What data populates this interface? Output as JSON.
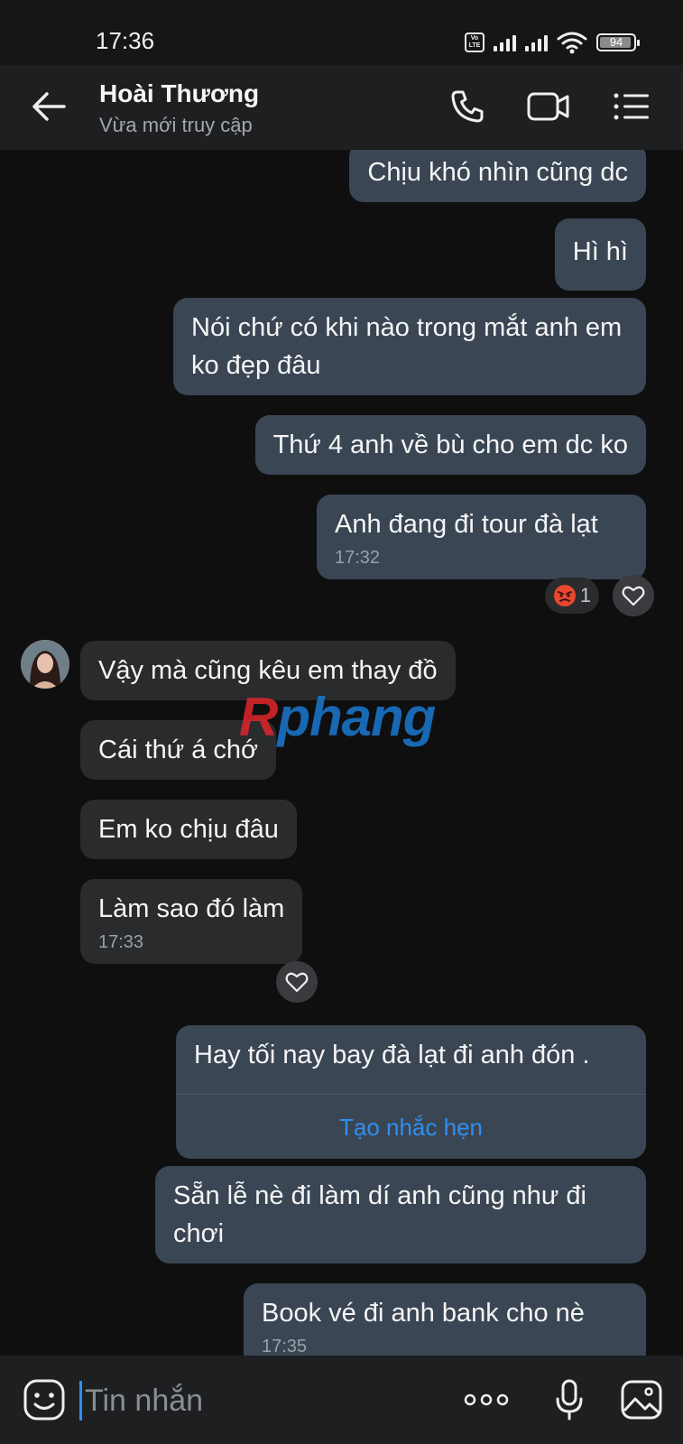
{
  "status_bar": {
    "time": "17:36",
    "volte": "Vo LTE",
    "battery": "94",
    "battery_level_percent": 94
  },
  "header": {
    "contact_name": "Hoài Thương",
    "contact_status": "Vừa mới truy cập",
    "icons": [
      "back-arrow-icon",
      "phone-icon",
      "video-call-icon",
      "menu-list-icon"
    ]
  },
  "messages": [
    {
      "side": "out",
      "text": "Chịu khó nhìn cũng dc"
    },
    {
      "side": "out",
      "text": "Hì hì"
    },
    {
      "side": "out",
      "text": "Nói chứ có khi nào trong mắt anh em ko đẹp đâu"
    },
    {
      "side": "out",
      "text": "Thứ 4 anh về bù cho em dc ko"
    },
    {
      "side": "out",
      "text": "Anh đang đi tour đà lạt",
      "time": "17:32",
      "reaction_count": "1",
      "reaction_icon": "angry-face-icon"
    },
    {
      "side": "in",
      "text": "Vậy mà cũng kêu em thay đồ"
    },
    {
      "side": "in",
      "text": "Cái thứ á chớ"
    },
    {
      "side": "in",
      "text": "Em ko chịu đâu"
    },
    {
      "side": "in",
      "text": "Làm sao đó làm",
      "time": "17:33"
    },
    {
      "side": "out",
      "text": "Hay tối nay bay đà lạt đi anh đón .",
      "action": "Tạo nhắc hẹn"
    },
    {
      "side": "out",
      "text": "Sẵn lễ nè đi làm dí anh cũng như đi chơi"
    },
    {
      "side": "out",
      "text": "Book vé đi anh bank cho nè",
      "time": "17:35"
    }
  ],
  "watermark": {
    "part1": "R",
    "part2": "phang"
  },
  "input_bar": {
    "placeholder": "Tin nhắn",
    "icons": [
      "emoji-sticker-icon",
      "more-options-icon",
      "microphone-icon",
      "image-icon"
    ]
  },
  "colors": {
    "background": "#0f0f10",
    "outgoing_bubble": "#3b4654",
    "incoming_bubble": "#2a2b2d",
    "accent": "#2f8ff1"
  }
}
